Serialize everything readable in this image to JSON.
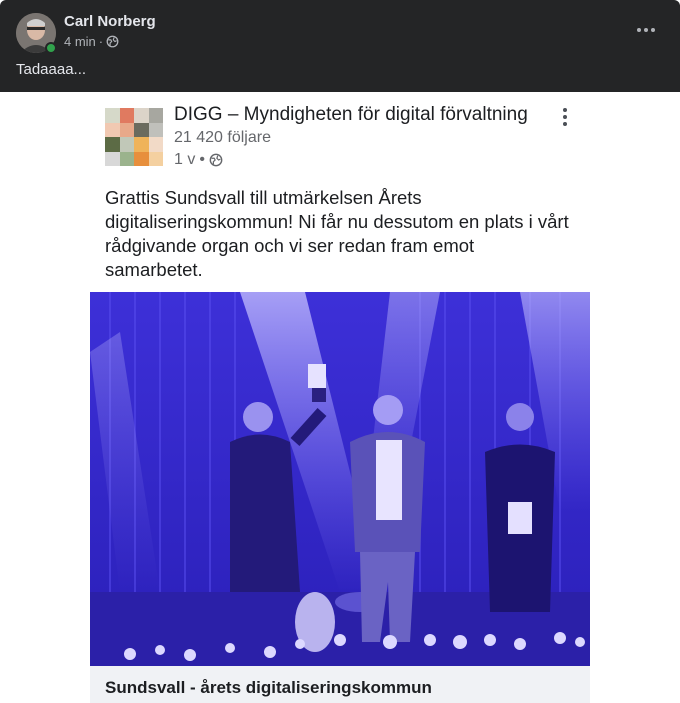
{
  "post": {
    "author": "Carl Norberg",
    "time": "4 min",
    "separator": "·",
    "text": "Tadaaaa...",
    "icons": {
      "globe": "globe-icon",
      "more": "more-options-icon",
      "avatar": "profile-photo"
    }
  },
  "shared": {
    "page_name": "DIGG – Myndigheten för digital förvaltning",
    "followers": "21 420 följare",
    "time": "1 v",
    "separator": "•",
    "body": "Grattis Sundsvall till utmärkelsen Årets digitaliseringskommun! Ni får nu dessutom en plats i vårt rådgivande organ och vi ser redan fram emot samarbetet.",
    "link_title": "Sundsvall - årets digitaliseringskommun",
    "colors": {
      "photo_tint": "#3a2ee0",
      "logo_palette": [
        "#c9d2b8",
        "#e07a60",
        "#8fa36e",
        "#c7c7c7",
        "#f1c9b2",
        "#e8a98a",
        "#6b6b5e",
        "#a8a8a8",
        "#5c6b45",
        "#c1c8b8",
        "#efb35a",
        "#f2dac7",
        "#d8d8d8",
        "#9bb38d",
        "#e78f3c",
        "#f4d0a0"
      ]
    }
  }
}
